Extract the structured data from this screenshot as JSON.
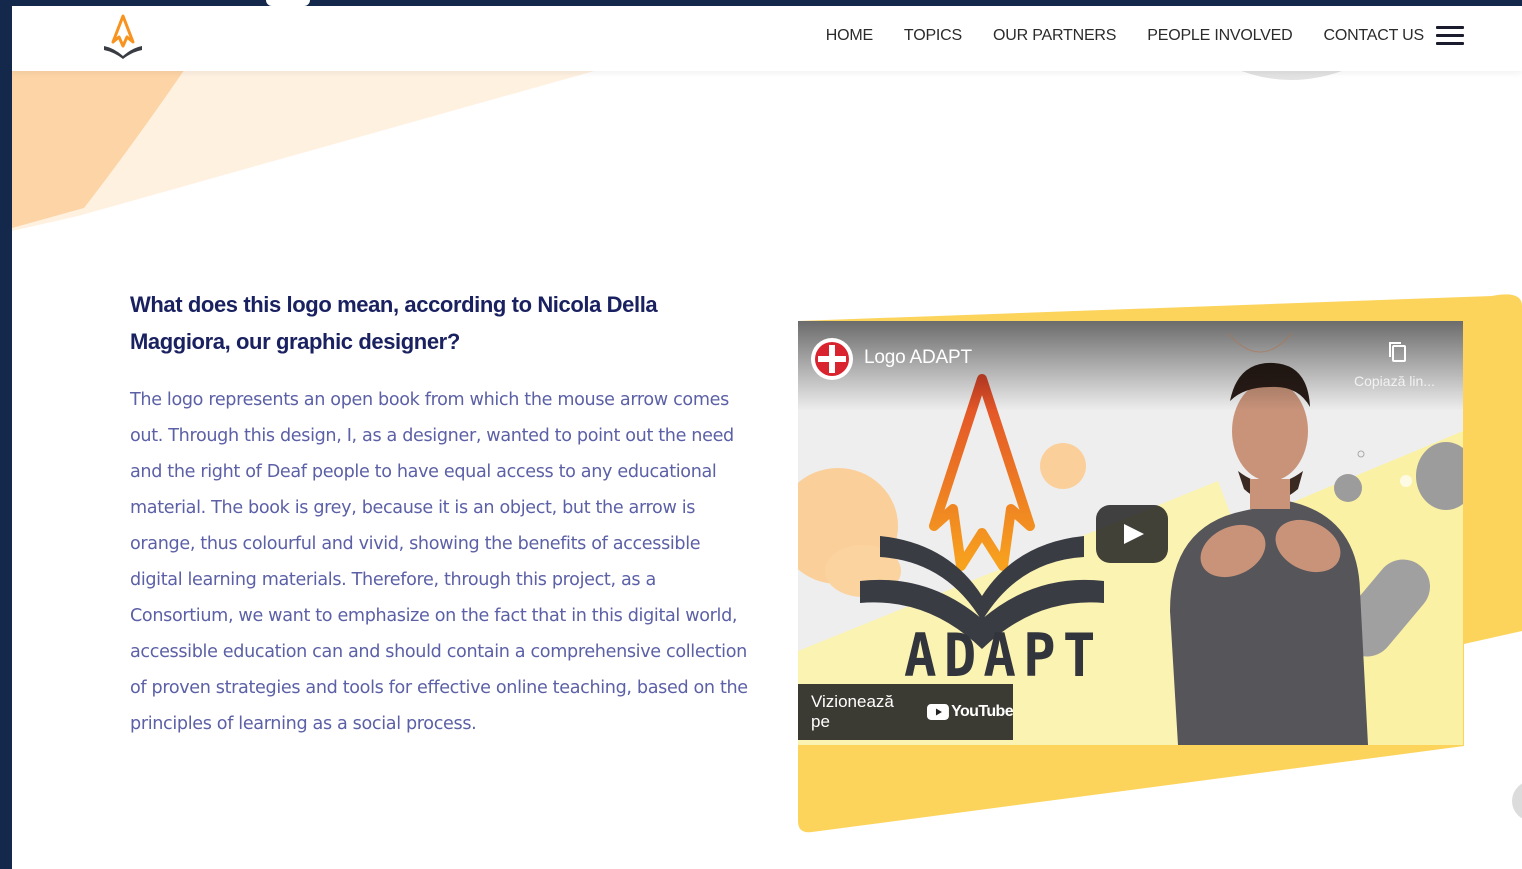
{
  "colors": {
    "frame": "#13284a",
    "heading": "#1a2160",
    "body_text": "#5c60a6",
    "accent_orange": "#f7931e",
    "accent_yellow": "#fbd35a"
  },
  "header": {
    "logo_icon": "adapt-book-arrow-logo",
    "nav": [
      {
        "label": "HOME"
      },
      {
        "label": "TOPICS"
      },
      {
        "label": "OUR PARTNERS"
      },
      {
        "label": "PEOPLE INVOLVED"
      },
      {
        "label": "CONTACT US"
      }
    ],
    "menu_icon": "hamburger-icon"
  },
  "main": {
    "heading": "What does this logo mean, according to Nicola Della Maggiora, our graphic designer?",
    "body": "The logo represents an open book from which the mouse arrow comes out. Through this design, I, as a designer, wanted to point out the need and the right of Deaf people to have equal access to any educational material. The book is grey, because it is an object, but the arrow is orange, thus colourful and vivid, showing the benefits of accessible digital learning materials. Therefore, through this project, as a Consortium, we want to emphasize on the fact that in this digital world, accessible education can and should contain a comprehensive collection of proven strategies and tools for effective online teaching, based on the principles of learning as a social process."
  },
  "video": {
    "title": "Logo ADAPT",
    "copy_link_label": "Copiază lin...",
    "watch_on_label": "Vizionează pe",
    "youtube_wordmark": "YouTube",
    "thumbnail_word": "ADAPT",
    "play_icon": "play-icon",
    "copy_icon": "copy-icon",
    "channel_icon": "channel-avatar-icon"
  }
}
